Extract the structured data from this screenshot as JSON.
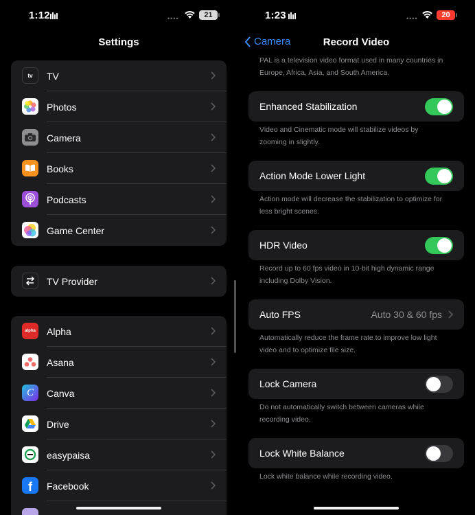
{
  "left": {
    "status": {
      "time": "1:12",
      "battery": "21"
    },
    "nav": {
      "title": "Settings"
    },
    "groups": [
      {
        "items": [
          {
            "label": "TV",
            "icon": "apple-tv-icon",
            "icon_text": "tv"
          },
          {
            "label": "Photos",
            "icon": "photos-icon"
          },
          {
            "label": "Camera",
            "icon": "camera-icon"
          },
          {
            "label": "Books",
            "icon": "books-icon"
          },
          {
            "label": "Podcasts",
            "icon": "podcasts-icon"
          },
          {
            "label": "Game Center",
            "icon": "game-center-icon"
          }
        ]
      },
      {
        "items": [
          {
            "label": "TV Provider",
            "icon": "tv-provider-icon"
          }
        ]
      },
      {
        "items": [
          {
            "label": "Alpha",
            "icon": "alpha-icon",
            "icon_text": "alpha"
          },
          {
            "label": "Asana",
            "icon": "asana-icon"
          },
          {
            "label": "Canva",
            "icon": "canva-icon",
            "icon_text": "C"
          },
          {
            "label": "Drive",
            "icon": "drive-icon"
          },
          {
            "label": "easypaisa",
            "icon": "easypaisa-icon"
          },
          {
            "label": "Facebook",
            "icon": "facebook-icon",
            "icon_text": "f"
          }
        ]
      }
    ]
  },
  "right": {
    "status": {
      "time": "1:23",
      "battery": "20"
    },
    "nav": {
      "back_label": "Camera",
      "title": "Record Video"
    },
    "intro_note": {
      "line1": "PAL is a television video format used in many countries in",
      "line2": "Europe, Africa, Asia, and South America."
    },
    "settings": [
      {
        "title": "Enhanced Stabilization",
        "control": "toggle",
        "state": "on",
        "note_line1": "Video and Cinematic mode will stabilize videos by",
        "note_line2": "zooming in slightly."
      },
      {
        "title": "Action Mode Lower Light",
        "control": "toggle",
        "state": "on",
        "note_line1": "Action mode will decrease the stabilization to optimize for",
        "note_line2": "less bright scenes."
      },
      {
        "title": "HDR Video",
        "control": "toggle",
        "state": "on",
        "note_line1": "Record up to 60 fps video in 10-bit high dynamic range",
        "note_line2": "including Dolby Vision."
      },
      {
        "title": "Auto FPS",
        "control": "value",
        "value": "Auto 30 & 60 fps",
        "note_line1": "Automatically reduce the frame rate to improve low light",
        "note_line2": "video and to optimize file size."
      },
      {
        "title": "Lock Camera",
        "control": "toggle",
        "state": "off",
        "note_line1": "Do not automatically switch between cameras while",
        "note_line2": "recording video."
      },
      {
        "title": "Lock White Balance",
        "control": "toggle",
        "state": "off",
        "note_line1": "Lock white balance while recording video.",
        "note_line2": ""
      }
    ]
  },
  "colors": {
    "accent_blue": "#3a8dff",
    "toggle_on": "#34c759",
    "toggle_off": "#39393d",
    "cell_bg": "#1c1c1e",
    "secondary_text": "#8e8e93"
  }
}
